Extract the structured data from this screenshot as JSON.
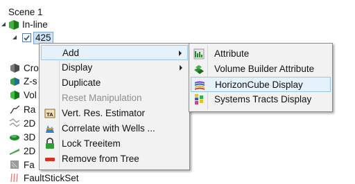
{
  "tree": {
    "items": [
      {
        "label": "Scene 1"
      },
      {
        "label": "In-line"
      },
      {
        "label": "425"
      },
      {
        "label": "Cro"
      },
      {
        "label": "Z-s"
      },
      {
        "label": "Vol"
      },
      {
        "label": "Ra"
      },
      {
        "label": "2D"
      },
      {
        "label": "3D"
      },
      {
        "label": "2D"
      },
      {
        "label": "Fa"
      },
      {
        "label": "FaultStickSet"
      }
    ]
  },
  "context_menu": {
    "items": [
      {
        "label": "Add",
        "icon": "",
        "submenu": true,
        "enabled": true,
        "highlighted": true
      },
      {
        "label": "Display",
        "icon": "",
        "submenu": true,
        "enabled": true
      },
      {
        "label": "Duplicate",
        "icon": "",
        "enabled": true
      },
      {
        "label": "Reset Manipulation",
        "icon": "",
        "enabled": false
      },
      {
        "label": "Vert. Res. Estimator",
        "icon": "vert-res-estimator-icon",
        "enabled": true
      },
      {
        "label": "Correlate with Wells ...",
        "icon": "correlate-wells-icon",
        "enabled": true
      },
      {
        "label": "Lock Treeitem",
        "icon": "lock-icon",
        "enabled": true
      },
      {
        "label": "Remove from Tree",
        "icon": "remove-icon",
        "enabled": true
      }
    ]
  },
  "add_submenu": {
    "items": [
      {
        "label": "Attribute",
        "icon": "attribute-icon"
      },
      {
        "label": "Volume Builder Attribute",
        "icon": "volume-builder-icon"
      },
      {
        "label": "HorizonCube Display",
        "icon": "horizoncube-icon",
        "highlighted": true
      },
      {
        "label": "Systems Tracts Display",
        "icon": "systems-tracts-icon"
      }
    ]
  }
}
